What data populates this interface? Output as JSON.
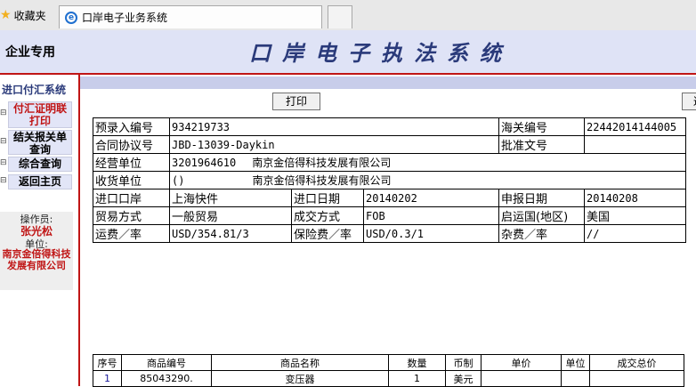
{
  "browser": {
    "favorites": "收藏夹",
    "tab_title": "口岸电子业务系统"
  },
  "header": {
    "corp_label": "企业专用",
    "system_title": "口岸电子执法系统"
  },
  "sidebar": {
    "title": "进口付汇系统",
    "items": [
      {
        "label": "付汇证明联打印",
        "active": true
      },
      {
        "label": "结关报关单查询",
        "active": false
      },
      {
        "label": "综合查询",
        "active": false
      },
      {
        "label": "返回主页",
        "active": false
      }
    ],
    "operator_label": "操作员:",
    "operator_name": "张光松",
    "unit_label": "单位:",
    "unit_name": "南京金倍得科技发展有限公司"
  },
  "toolbar": {
    "print_label": "打印",
    "second_label": "返"
  },
  "form": {
    "pre_entry_label": "预录入编号",
    "pre_entry_value": "934219733",
    "customs_no_label": "海关编号",
    "customs_no_value": "22442014144005",
    "contract_label": "合同协议号",
    "contract_value": "JBD-13039-Daykin",
    "approval_label": "批准文号",
    "approval_value": "",
    "operator_unit_label": "经营单位",
    "operator_unit_code": "3201964610",
    "operator_unit_name": "南京金倍得科技发展有限公司",
    "consignee_label": "收货单位",
    "consignee_code": "()",
    "consignee_name": "南京金倍得科技发展有限公司",
    "port_label": "进口口岸",
    "port_value": "上海快件",
    "import_date_label": "进口日期",
    "import_date_value": "20140202",
    "declare_date_label": "申报日期",
    "declare_date_value": "20140208",
    "trade_mode_label": "贸易方式",
    "trade_mode_value": "一般贸易",
    "deal_mode_label": "成交方式",
    "deal_mode_value": "FOB",
    "origin_label": "启运国(地区)",
    "origin_value": "美国",
    "freight_label": "运费／率",
    "freight_value": "USD/354.81/3",
    "insurance_label": "保险费／率",
    "insurance_value": "USD/0.3/1",
    "misc_label": "杂费／率",
    "misc_value": "//"
  },
  "goods": {
    "headers": [
      "序号",
      "商品编号",
      "商品名称",
      "数量",
      "币制",
      "单价",
      "单位",
      "成交总价"
    ],
    "rows": [
      [
        "1",
        "85043290.",
        "变压器",
        "1",
        "美元",
        "",
        "",
        ""
      ]
    ]
  }
}
